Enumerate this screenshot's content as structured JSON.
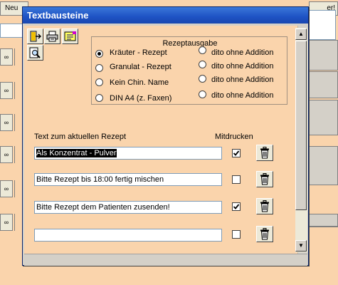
{
  "background": {
    "tab_left": "Neu",
    "tab_right": "er!"
  },
  "dialog": {
    "title": "Textbausteine",
    "toolbar": {
      "exit_icon": "exit-door-icon",
      "print_icon": "printer-icon",
      "note_icon": "notepad-icon",
      "preview_icon": "print-preview-icon"
    },
    "rezeptausgabe": {
      "title": "Rezeptausgabe",
      "left_options": [
        {
          "label": "Kräuter - Rezept",
          "selected": true
        },
        {
          "label": "Granulat - Rezept",
          "selected": false
        },
        {
          "label": "Kein Chin. Name",
          "selected": false
        },
        {
          "label": "DIN A4 (z. Faxen)",
          "selected": false
        }
      ],
      "right_options": [
        {
          "label": "dito ohne Addition",
          "selected": false
        },
        {
          "label": "dito ohne Addition",
          "selected": false
        },
        {
          "label": "dito ohne Addition",
          "selected": false
        },
        {
          "label": "dito ohne Addition",
          "selected": false
        }
      ]
    },
    "text_header": "Text zum aktuellen Rezept",
    "print_header": "Mitdrucken",
    "rows": [
      {
        "text": "Als Konzentrat - Pulver",
        "selected": true,
        "mitdrucken": true
      },
      {
        "text": "Bitte Rezept bis 18:00 fertig mischen",
        "selected": false,
        "mitdrucken": false
      },
      {
        "text": "Bitte Rezept dem Patienten zusenden!",
        "selected": false,
        "mitdrucken": true
      },
      {
        "text": "",
        "selected": false,
        "mitdrucken": false
      }
    ],
    "delete_icon": "trash-icon",
    "colors": {
      "form_background": "#fad4ac",
      "titlebar": "#1e52c4"
    }
  }
}
